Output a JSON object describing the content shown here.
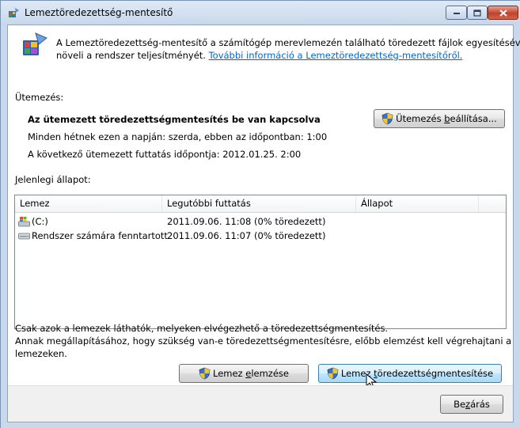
{
  "window": {
    "title": "Lemeztöredezettség-mentesítő"
  },
  "intro": {
    "line1": "A Lemeztöredezettség-mentesítő a számítógép merevlemezén található töredezett fájlok egyesítésével",
    "line2_prefix": "növeli a rendszer teljesítményét. ",
    "link": "További információ a Lemeztöredezettség-mentesítőről."
  },
  "schedule": {
    "section_label": "Ütemezés:",
    "status": "Az ütemezett töredezettségmentesítés be van kapcsolva",
    "frequency": "Minden hétnek ezen a napján: szerda, ebben az időpontban: 1:00",
    "next_run": "A következő ütemezett futtatás időpontja: 2012.01.25. 2:00",
    "button_pre": "Ütemezés ",
    "button_ul": "b",
    "button_post": "eállítása..."
  },
  "current_status": {
    "label_ul": "J",
    "label_rest": "elenlegi állapot:",
    "columns": [
      "Lemez",
      "Legutóbbi futtatás",
      "Állapot"
    ],
    "rows": [
      {
        "disk": "(C:)",
        "last_run": "2011.09.06. 11:08 (0% töredezett)",
        "status": ""
      },
      {
        "disk": "Rendszer számára fenntartott",
        "last_run": "2011.09.06. 11:07 (0% töredezett)",
        "status": ""
      }
    ]
  },
  "notes": {
    "line1": "Csak azok a lemezek láthatók, melyeken elvégezhető a töredezettségmentesítés.",
    "line2": "Annak megállapításához, hogy szükség van-e töredezettségmentesítésre, előbb elemzést kell végrehajtani a",
    "line3": "lemezeken."
  },
  "actions": {
    "analyze_pre": "Lemez ",
    "analyze_ul": "e",
    "analyze_post": "lemzése",
    "defrag_pre": "Lemez ",
    "defrag_ul": "t",
    "defrag_post": "öredezettségmentesítése"
  },
  "footer": {
    "close_pre": "Be",
    "close_ul": "z",
    "close_post": "árás"
  },
  "colors": {
    "link": "#0066cc",
    "window_frame": "#c8d9ec",
    "close_button": "#c2412a",
    "hot_button_border": "#3c7fb1"
  }
}
